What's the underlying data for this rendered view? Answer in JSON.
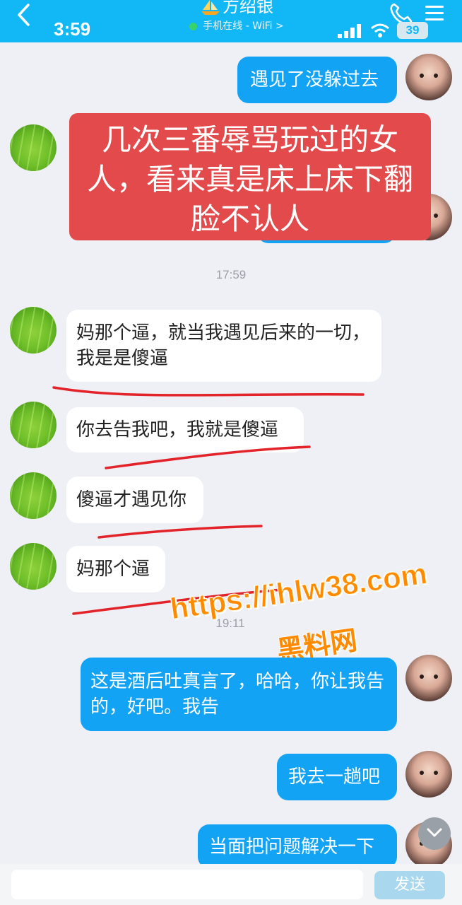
{
  "header": {
    "time": "3:59",
    "contact_name": "方绍银",
    "online_status": "手机在线 - WiFi >",
    "battery": "39",
    "back_glyph": "<",
    "colors": {
      "header_bg": "#12b7f5",
      "online_dot": "#38d36b"
    }
  },
  "messages": [
    {
      "side": "out",
      "text": "遇见了没躲过去"
    },
    {
      "side": "in",
      "text": ""
    },
    {
      "side": "time",
      "text": "17:59"
    },
    {
      "side": "in",
      "text": "妈那个逼，就当我遇见后来的一切，我是是傻逼"
    },
    {
      "side": "in",
      "text": "你去告我吧，我就是傻逼"
    },
    {
      "side": "in",
      "text": "傻逼才遇见你"
    },
    {
      "side": "in",
      "text": "妈那个逼"
    },
    {
      "side": "time",
      "text": "19:11"
    },
    {
      "side": "out",
      "text": "这是酒后吐真言了，哈哈，你让我告的，好吧。我告"
    },
    {
      "side": "out",
      "text": "我去一趟吧"
    },
    {
      "side": "out",
      "text": "当面把问题解决一下"
    }
  ],
  "overlay": {
    "note_text": "几次三番辱骂玩过的女人，看来真是床上床下翻脸不认人",
    "watermark_url": "https://ihlw38.com",
    "watermark_name": "黑料网",
    "colors": {
      "note_bg": "#e24a4c",
      "watermark": "#ff8a00",
      "underline": "#e2232a"
    }
  },
  "input": {
    "send_label": "发送"
  },
  "icons": [
    "back-chevron-icon",
    "boat-icon",
    "phone-icon",
    "menu-icon",
    "signal-icon",
    "wifi-icon",
    "chevron-down-icon"
  ]
}
